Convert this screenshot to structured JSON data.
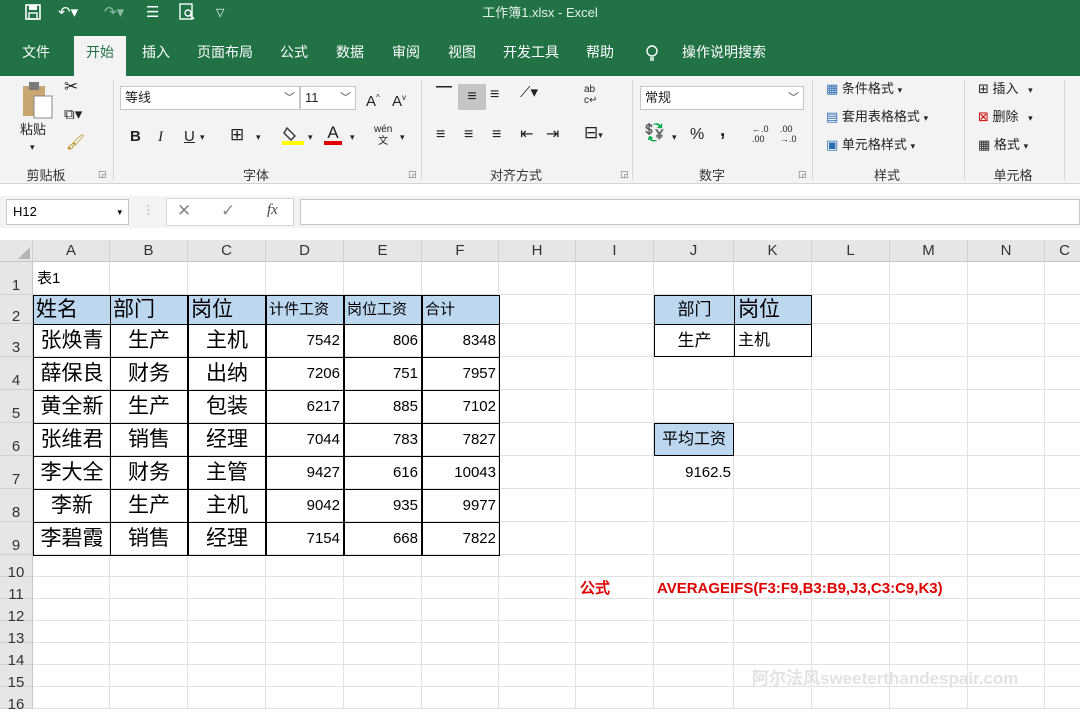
{
  "window": {
    "title": "工作簿1.xlsx  -  Excel"
  },
  "tabs": [
    "文件",
    "开始",
    "插入",
    "页面布局",
    "公式",
    "数据",
    "审阅",
    "视图",
    "开发工具",
    "帮助"
  ],
  "tell_me": "操作说明搜索",
  "ribbon": {
    "clipboard": {
      "paste": "粘贴",
      "label": "剪贴板"
    },
    "font": {
      "name": "等线",
      "size": "11",
      "bold": "B",
      "italic": "I",
      "underline": "U",
      "label": "字体",
      "grow": "A",
      "shrink": "A",
      "color_letter": "A",
      "phonetic": "wén\n文"
    },
    "alignment": {
      "label": "对齐方式",
      "wrap": "ab\nc↵"
    },
    "number": {
      "format": "常规",
      "percent": "%",
      "comma": ",",
      "inc": "←.0\n.00",
      "dec": ".00\n→.0",
      "label": "数字"
    },
    "styles": {
      "conditional": "条件格式",
      "table": "套用表格格式",
      "cell": "单元格样式",
      "label": "样式"
    },
    "cells": {
      "insert": "插入",
      "delete": "删除",
      "format": "格式",
      "label": "单元格"
    }
  },
  "formula_bar": {
    "name_box": "H12",
    "fx": "fx",
    "value": ""
  },
  "columns": [
    "A",
    "B",
    "C",
    "D",
    "E",
    "F",
    "H",
    "I",
    "J",
    "K",
    "L",
    "M",
    "N",
    "C"
  ],
  "rows": [
    "1",
    "2",
    "3",
    "4",
    "5",
    "6",
    "7",
    "8",
    "9",
    "10",
    "11",
    "12",
    "13",
    "14",
    "15",
    "16"
  ],
  "sheet": {
    "a1": "表1",
    "headers": [
      "姓名",
      "部门",
      "岗位",
      "计件工资",
      "岗位工资",
      "合计"
    ],
    "data": [
      [
        "张焕青",
        "生产",
        "主机",
        "7542",
        "806",
        "8348"
      ],
      [
        "薛保良",
        "财务",
        "出纳",
        "7206",
        "751",
        "7957"
      ],
      [
        "黄全新",
        "生产",
        "包装",
        "6217",
        "885",
        "7102"
      ],
      [
        "张维君",
        "销售",
        "经理",
        "7044",
        "783",
        "7827"
      ],
      [
        "李大全",
        "财务",
        "主管",
        "9427",
        "616",
        "10043"
      ],
      [
        "李新",
        "生产",
        "主机",
        "9042",
        "935",
        "9977"
      ],
      [
        "李碧霞",
        "销售",
        "经理",
        "7154",
        "668",
        "7822"
      ]
    ],
    "criteria_headers": [
      "部门",
      "岗位"
    ],
    "criteria_values": [
      "生产",
      "主机"
    ],
    "avg_label": "平均工资",
    "avg_value": "9162.5",
    "formula_label": "公式",
    "formula_text": "AVERAGEIFS(F3:F9,B3:B9,J3,C3:C9,K3)"
  },
  "watermark": "阿尔法风sweeterthandespair.com",
  "colors": {
    "excel_green": "#217346",
    "header_fill": "#bdd7ee",
    "formula_red": "#e00000"
  }
}
